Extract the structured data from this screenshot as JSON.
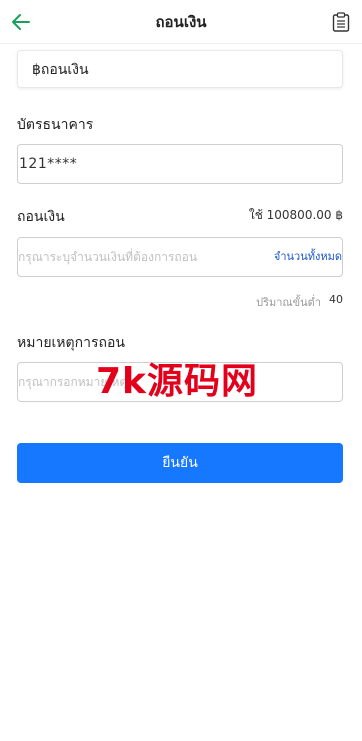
{
  "header": {
    "title": "ถอนเงิน",
    "back_icon": "arrow-left-icon",
    "record_icon": "clipboard-list-icon",
    "accent": "#1aa05a"
  },
  "method": {
    "label": "฿ถอนเงิน"
  },
  "bank_card": {
    "label": "บัตรธนาคาร",
    "value": "121****"
  },
  "withdraw": {
    "label": "ถอนเงิน",
    "balance": "ใช้ 100800.00 ฿",
    "placeholder": "กรุณาระบุจำนวนเงินที่ต้องการถอน",
    "all_label": "จำนวนทั้งหมด",
    "min_label": "ปริมาณขั้นต่ำ",
    "min_value": "40"
  },
  "remark": {
    "label": "หมายเหตุการถอน",
    "placeholder": "กรุณากรอกหมายเหตุ"
  },
  "watermark": "7k源码网",
  "submit": {
    "label": "ยืนยัน",
    "color": "#1677ff"
  }
}
